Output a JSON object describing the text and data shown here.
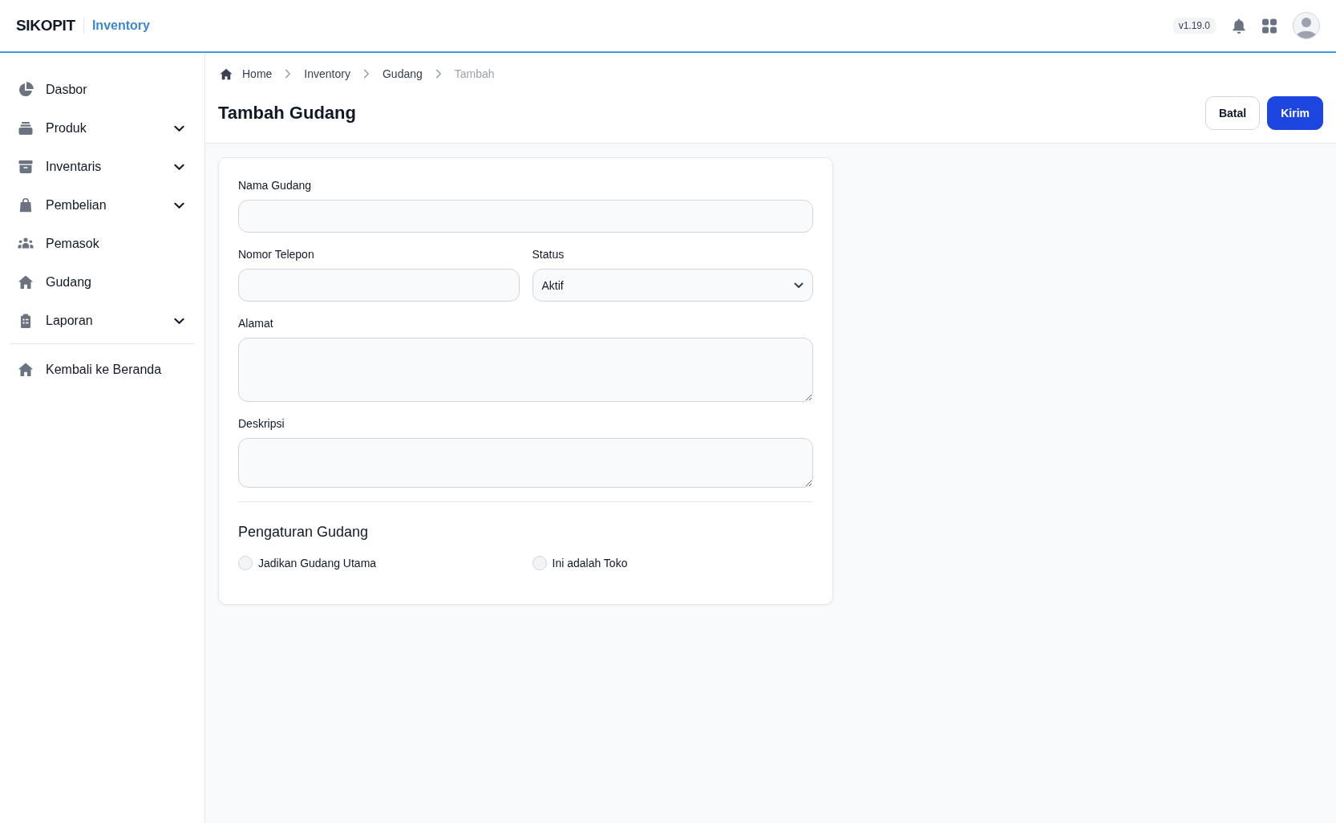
{
  "header": {
    "logo": "SIKOPIT",
    "app_name": "Inventory",
    "version": "v1.19.0"
  },
  "sidebar": {
    "items": [
      {
        "label": "Dasbor",
        "kind": "link"
      },
      {
        "label": "Produk",
        "kind": "group",
        "expanded": false
      },
      {
        "label": "Inventaris",
        "kind": "group",
        "expanded": false
      },
      {
        "label": "Pembelian",
        "kind": "group",
        "expanded": false
      },
      {
        "label": "Pemasok",
        "kind": "link"
      },
      {
        "label": "Gudang",
        "kind": "link"
      },
      {
        "label": "Laporan",
        "kind": "group",
        "expanded": false
      }
    ],
    "footer_link": "Kembali ke Beranda"
  },
  "breadcrumb": [
    {
      "label": "Home",
      "current": false
    },
    {
      "label": "Inventory",
      "current": false
    },
    {
      "label": "Gudang",
      "current": false
    },
    {
      "label": "Tambah",
      "current": true
    }
  ],
  "page": {
    "title": "Tambah Gudang",
    "buttons": [
      {
        "label": "Batal",
        "kind": "secondary"
      },
      {
        "label": "Kirim",
        "kind": "primary"
      }
    ]
  },
  "form": {
    "rows": [
      [
        {
          "label": "Nama Gudang",
          "kind": "text"
        }
      ],
      [
        {
          "label": "Nomor Telepon",
          "kind": "text"
        },
        {
          "label": "Status",
          "kind": "select",
          "value": "Aktif"
        }
      ],
      [
        {
          "label": "Alamat",
          "kind": "textarea"
        }
      ],
      [
        {
          "label": "Deskripsi",
          "kind": "textarea"
        }
      ]
    ],
    "settings": {
      "title": "Pengaturan Gudang",
      "options": [
        {
          "label": "Jadikan Gudang Utama",
          "checked": false
        },
        {
          "label": "Ini adalah Toko",
          "checked": false
        }
      ]
    }
  }
}
